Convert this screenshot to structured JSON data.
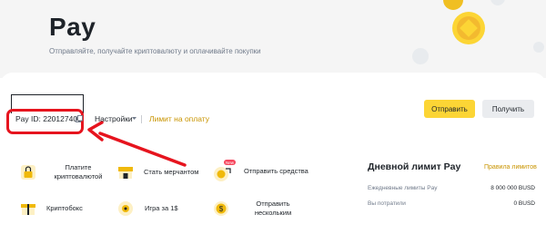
{
  "hero": {
    "title": "Pay",
    "subtitle": "Отправляйте, получайте криптовалюту и оплачивайте покупки"
  },
  "toolbar": {
    "pay_id": "Pay ID: 220127409",
    "settings_label": "Настройки",
    "limit_link": "Лимит на оплату",
    "send_label": "Отправить",
    "receive_label": "Получить"
  },
  "actions": [
    {
      "label_1": "Платите",
      "label_2": "криптовалютой",
      "icon": "lock-icon"
    },
    {
      "label_1": "Стать мерчантом",
      "icon": "store-icon"
    },
    {
      "label_1": "Отправить средства",
      "icon": "send-funds-icon",
      "badge": "New"
    },
    {
      "label_1": "Криптобокс",
      "icon": "gift-box-icon"
    },
    {
      "label_1": "Игра за 1$",
      "icon": "game-icon"
    },
    {
      "label_1": "Отправить",
      "label_2": "нескольким",
      "icon": "multi-send-icon"
    }
  ],
  "limits": {
    "title": "Дневной лимит Pay",
    "rules_link": "Правила лимитов",
    "rows": [
      {
        "label": "Ежедневные лимиты Pay",
        "value": "8 000 000 BUSD"
      },
      {
        "label": "Вы потратили",
        "value": "0 BUSD"
      }
    ]
  },
  "colors": {
    "accent": "#fcd535",
    "link": "#c99400",
    "highlight": "#e6141e"
  }
}
